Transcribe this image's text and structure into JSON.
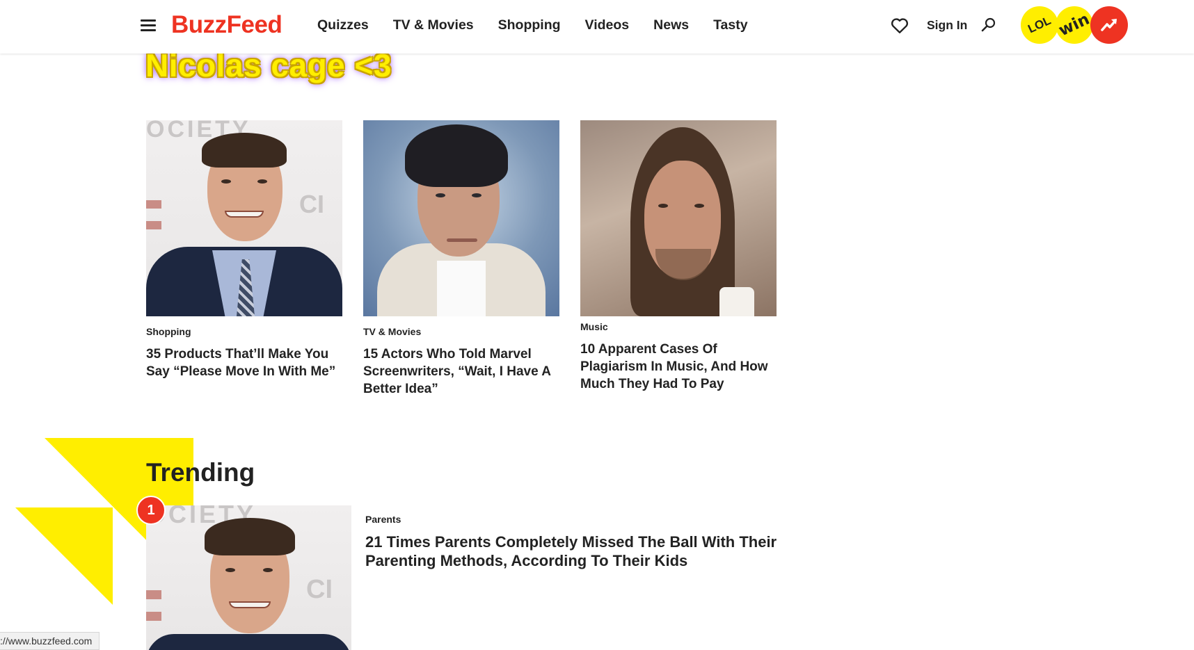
{
  "header": {
    "logo": "BuzzFeed",
    "nav": [
      "Quizzes",
      "TV & Movies",
      "Shopping",
      "Videos",
      "News",
      "Tasty"
    ],
    "sign_in": "Sign In",
    "badges": {
      "lol": "LOL",
      "win": "win"
    }
  },
  "page_title": "Nicolas cage <3",
  "cards": [
    {
      "category": "Shopping",
      "title": "35 Products That’ll Make You Say “Please Move In With Me”"
    },
    {
      "category": "TV & Movies",
      "title": "15 Actors Who Told Marvel Screenwriters, “Wait, I Have A Better Idea”"
    },
    {
      "category": "Music",
      "title": "10 Apparent Cases Of Plagiarism In Music, And How Much They Had To Pay"
    }
  ],
  "trending": {
    "heading": "Trending",
    "items": [
      {
        "rank": "1",
        "category": "Parents",
        "title": "21 Times Parents Completely Missed The Ball With Their Parenting Methods, According To Their Kids"
      }
    ]
  },
  "status_bar": {
    "url": "://www.buzzfeed.com"
  },
  "colors": {
    "brand_red": "#ee3322",
    "brand_yellow": "#ffee00",
    "text": "#222222"
  }
}
